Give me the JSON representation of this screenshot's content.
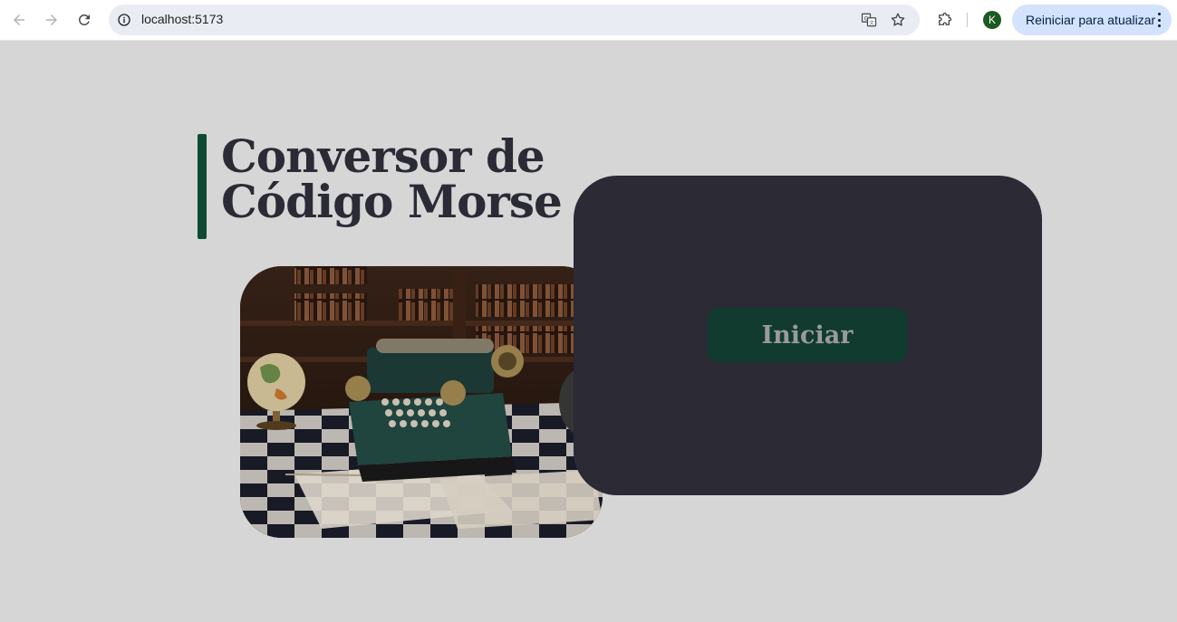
{
  "browser": {
    "url": "localhost:5173",
    "update_button_label": "Reiniciar para atualizar",
    "profile_initial": "K",
    "profile_color": "#1d5a1f",
    "icons": [
      "back-icon",
      "forward-icon",
      "reload-icon",
      "site-info-icon",
      "translate-icon",
      "bookmark-star-icon",
      "extensions-icon",
      "more-vert-icon"
    ]
  },
  "page": {
    "title_line1": "Conversor de",
    "title_line2": "Código Morse",
    "start_button_label": "Iniciar",
    "image_subject": "typewriter-telegraph-illustration",
    "colors": {
      "background": "#d6d6d6",
      "accent": "#0f4a33",
      "panel": "#2b2a35",
      "button": "#103b2e",
      "title": "#2b2b36"
    }
  }
}
